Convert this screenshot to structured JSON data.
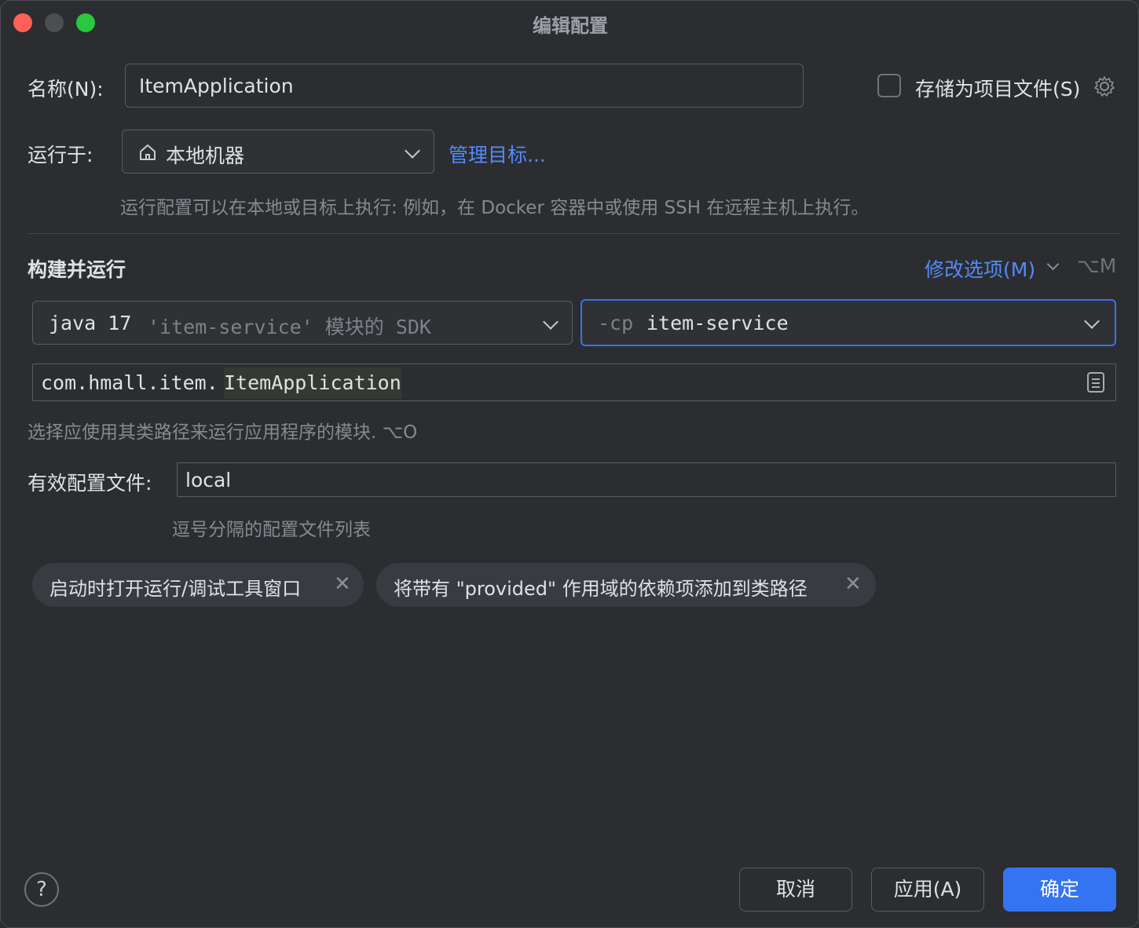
{
  "window": {
    "title": "编辑配置"
  },
  "name_row": {
    "label": "名称(N):",
    "value": "ItemApplication",
    "store_label": "存储为项目文件(S)",
    "store_checked": false
  },
  "run_on": {
    "label": "运行于:",
    "target": "本地机器",
    "manage_link": "管理目标...",
    "hint": "运行配置可以在本地或目标上执行: 例如，在 Docker 容器中或使用 SSH 在远程主机上执行。"
  },
  "build_run": {
    "section_title": "构建并运行",
    "modify_options": "修改选项(M)",
    "modify_shortcut": "⌥M",
    "sdk_prefix": "java 17",
    "sdk_suffix": "'item-service' 模块的 SDK",
    "cp_flag": "-cp",
    "cp_value": "item-service",
    "main_class_package": "com.hmall.item.",
    "main_class_name": "ItemApplication",
    "module_hint": "选择应使用其类路径来运行应用程序的模块. ⌥O"
  },
  "profiles": {
    "label": "有效配置文件:",
    "value": "local",
    "hint": "逗号分隔的配置文件列表"
  },
  "chips": [
    {
      "label": "启动时打开运行/调试工具窗口"
    },
    {
      "label": "将带有 \"provided\" 作用域的依赖项添加到类路径"
    }
  ],
  "footer": {
    "help": "?",
    "cancel": "取消",
    "apply": "应用(A)",
    "ok": "确定"
  },
  "colors": {
    "background": "#2b2d30",
    "accent": "#3574f0",
    "link": "#548af7",
    "focus_border": "#3574f0"
  }
}
